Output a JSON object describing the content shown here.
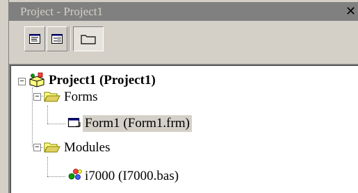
{
  "window": {
    "title": "Project - Project1",
    "close_glyph": "✕"
  },
  "toolbar": {
    "buttons": [
      {
        "name": "view-code-button",
        "icon": "view-code-icon"
      },
      {
        "name": "view-object-button",
        "icon": "view-object-icon"
      },
      {
        "name": "toggle-folders-button",
        "icon": "folder-icon"
      }
    ]
  },
  "tree": {
    "root": {
      "label": "Project1  (Project1)",
      "icon": "project-icon",
      "expanded": true
    },
    "forms_folder": {
      "label": "Forms",
      "icon": "folder-open-icon",
      "expanded": true
    },
    "form1": {
      "label": "Form1 (Form1.frm)",
      "icon": "form-icon",
      "selected": true
    },
    "modules_folder": {
      "label": "Modules",
      "icon": "folder-open-icon",
      "expanded": true
    },
    "module_i7000": {
      "label": "i7000 (I7000.bas)",
      "icon": "module-icon"
    }
  },
  "colors": {
    "face": "#d4d0c8",
    "titlebar_inactive": "#808080",
    "selection": "#d4d0c8",
    "folder_yellow": "#ffff80"
  }
}
